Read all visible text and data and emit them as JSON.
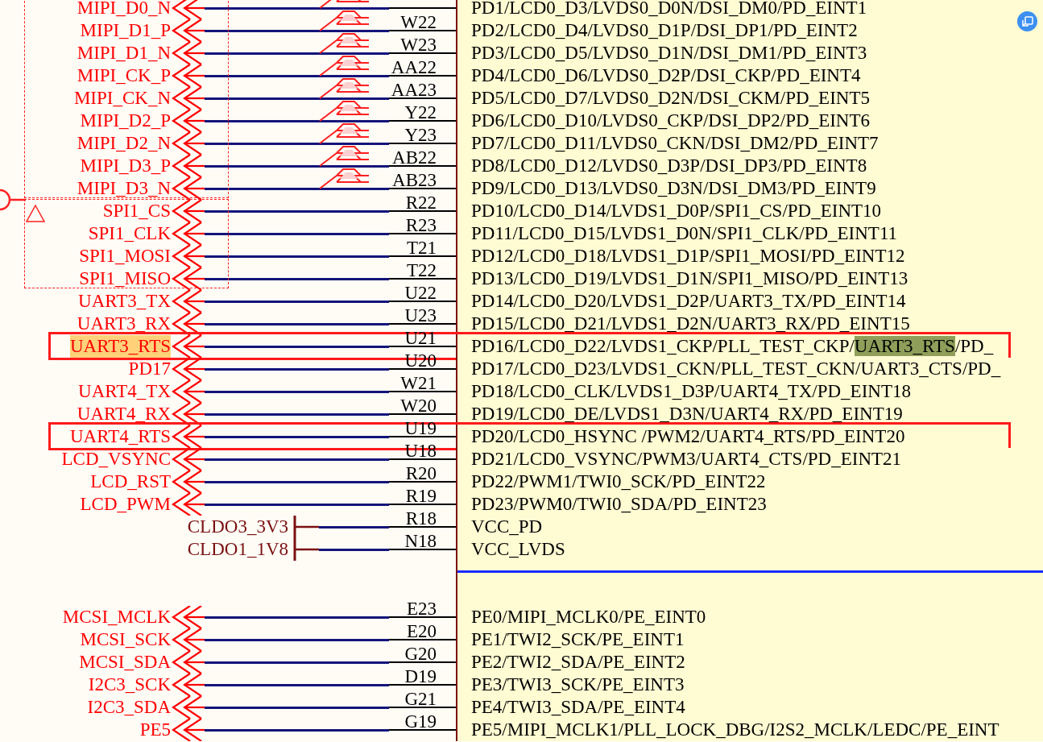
{
  "sections": [
    {
      "rows": [
        {
          "label": "MIPI_D0_N",
          "kind": "signal",
          "diff_pair": true,
          "label_highlighted": false,
          "boxed": false,
          "name_parts": [
            {
              "text": "PD1/LCD0_D3/LVDS0_D0N/DSI_DM0/PD_EINT1",
              "highlighted": false
            }
          ]
        },
        {
          "label": "MIPI_D1_P",
          "kind": "signal",
          "diff_pair": true,
          "label_highlighted": false,
          "boxed": false,
          "pin": "W22",
          "name_parts": [
            {
              "text": "PD2/LCD0_D4/LVDS0_D1P/DSI_DP1/PD_EINT2",
              "highlighted": false
            }
          ]
        },
        {
          "label": "MIPI_D1_N",
          "kind": "signal",
          "diff_pair": true,
          "label_highlighted": false,
          "boxed": false,
          "pin": "W23",
          "name_parts": [
            {
              "text": "PD3/LCD0_D5/LVDS0_D1N/DSI_DM1/PD_EINT3",
              "highlighted": false
            }
          ]
        },
        {
          "label": "MIPI_CK_P",
          "kind": "signal",
          "diff_pair": true,
          "label_highlighted": false,
          "boxed": false,
          "pin": "AA22",
          "name_parts": [
            {
              "text": "PD4/LCD0_D6/LVDS0_D2P/DSI_CKP/PD_EINT4",
              "highlighted": false
            }
          ]
        },
        {
          "label": "MIPI_CK_N",
          "kind": "signal",
          "diff_pair": true,
          "label_highlighted": false,
          "boxed": false,
          "pin": "AA23",
          "name_parts": [
            {
              "text": "PD5/LCD0_D7/LVDS0_D2N/DSI_CKM/PD_EINT5",
              "highlighted": false
            }
          ]
        },
        {
          "label": "MIPI_D2_P",
          "kind": "signal",
          "diff_pair": true,
          "label_highlighted": false,
          "boxed": false,
          "pin": "Y22",
          "name_parts": [
            {
              "text": "PD6/LCD0_D10/LVDS0_CKP/DSI_DP2/PD_EINT6",
              "highlighted": false
            }
          ]
        },
        {
          "label": "MIPI_D2_N",
          "kind": "signal",
          "diff_pair": true,
          "label_highlighted": false,
          "boxed": false,
          "pin": "Y23",
          "name_parts": [
            {
              "text": "PD7/LCD0_D11/LVDS0_CKN/DSI_DM2/PD_EINT7",
              "highlighted": false
            }
          ]
        },
        {
          "label": "MIPI_D3_P",
          "kind": "signal",
          "diff_pair": true,
          "label_highlighted": false,
          "boxed": false,
          "pin": "AB22",
          "name_parts": [
            {
              "text": "PD8/LCD0_D12/LVDS0_D3P/DSI_DP3/PD_EINT8",
              "highlighted": false
            }
          ]
        },
        {
          "label": "MIPI_D3_N",
          "kind": "signal",
          "diff_pair": true,
          "label_highlighted": false,
          "boxed": false,
          "pin": "AB23",
          "name_parts": [
            {
              "text": "PD9/LCD0_D13/LVDS0_D3N/DSI_DM3/PD_EINT9",
              "highlighted": false
            }
          ]
        },
        {
          "label": "SPI1_CS",
          "kind": "signal",
          "diff_pair": false,
          "label_highlighted": false,
          "boxed": false,
          "pin": "R22",
          "name_parts": [
            {
              "text": "PD10/LCD0_D14/LVDS1_D0P/SPI1_CS/PD_EINT10",
              "highlighted": false
            }
          ]
        },
        {
          "label": "SPI1_CLK",
          "kind": "signal",
          "diff_pair": false,
          "label_highlighted": false,
          "boxed": false,
          "pin": "R23",
          "name_parts": [
            {
              "text": "PD11/LCD0_D15/LVDS1_D0N/SPI1_CLK/PD_EINT11",
              "highlighted": false
            }
          ]
        },
        {
          "label": "SPI1_MOSI",
          "kind": "signal",
          "diff_pair": false,
          "label_highlighted": false,
          "boxed": false,
          "pin": "T21",
          "name_parts": [
            {
              "text": "PD12/LCD0_D18/LVDS1_D1P/SPI1_MOSI/PD_EINT12",
              "highlighted": false
            }
          ]
        },
        {
          "label": "SPI1_MISO",
          "kind": "signal",
          "diff_pair": false,
          "label_highlighted": false,
          "boxed": false,
          "pin": "T22",
          "name_parts": [
            {
              "text": "PD13/LCD0_D19/LVDS1_D1N/SPI1_MISO/PD_EINT13",
              "highlighted": false
            }
          ]
        },
        {
          "label": "UART3_TX",
          "kind": "signal",
          "diff_pair": false,
          "label_highlighted": false,
          "boxed": false,
          "pin": "U22",
          "name_parts": [
            {
              "text": "PD14/LCD0_D20/LVDS1_D2P/UART3_TX/PD_EINT14",
              "highlighted": false
            }
          ]
        },
        {
          "label": "UART3_RX",
          "kind": "signal",
          "diff_pair": false,
          "label_highlighted": false,
          "boxed": false,
          "pin": "U23",
          "name_parts": [
            {
              "text": "PD15/LCD0_D21/LVDS1_D2N/UART3_RX/PD_EINT15",
              "highlighted": false
            }
          ]
        },
        {
          "label": "UART3_RTS",
          "kind": "signal",
          "diff_pair": false,
          "label_highlighted": true,
          "boxed": true,
          "pin": "U21",
          "name_parts": [
            {
              "text": "PD16/LCD0_D22/LVDS1_CKP/PLL_TEST_CKP/",
              "highlighted": false
            },
            {
              "text": "UART3_RTS",
              "highlighted": true
            },
            {
              "text": "/PD_",
              "highlighted": false
            }
          ]
        },
        {
          "label": "PD17",
          "kind": "signal",
          "diff_pair": false,
          "label_highlighted": false,
          "boxed": false,
          "pin": "U20",
          "name_parts": [
            {
              "text": "PD17/LCD0_D23/LVDS1_CKN/PLL_TEST_CKN/UART3_CTS/PD_",
              "highlighted": false
            }
          ]
        },
        {
          "label": "UART4_TX",
          "kind": "signal",
          "diff_pair": false,
          "label_highlighted": false,
          "boxed": false,
          "pin": "W21",
          "name_parts": [
            {
              "text": "PD18/LCD0_CLK/LVDS1_D3P/UART4_TX/PD_EINT18",
              "highlighted": false
            }
          ]
        },
        {
          "label": "UART4_RX",
          "kind": "signal",
          "diff_pair": false,
          "label_highlighted": false,
          "boxed": false,
          "pin": "W20",
          "name_parts": [
            {
              "text": "PD19/LCD0_DE/LVDS1_D3N/UART4_RX/PD_EINT19",
              "highlighted": false
            }
          ]
        },
        {
          "label": "UART4_RTS",
          "kind": "signal",
          "diff_pair": false,
          "label_highlighted": false,
          "boxed": true,
          "pin": "U19",
          "name_parts": [
            {
              "text": "PD20/LCD0_HSYNC /PWM2/UART4_RTS/PD_EINT20",
              "highlighted": false
            }
          ]
        },
        {
          "label": "LCD_VSYNC",
          "kind": "signal",
          "diff_pair": false,
          "label_highlighted": false,
          "boxed": false,
          "pin": "U18",
          "name_parts": [
            {
              "text": "PD21/LCD0_VSYNC/PWM3/UART4_CTS/PD_EINT21",
              "highlighted": false
            }
          ]
        },
        {
          "label": "LCD_RST",
          "kind": "signal",
          "diff_pair": false,
          "label_highlighted": false,
          "boxed": false,
          "pin": "R20",
          "name_parts": [
            {
              "text": "PD22/PWM1/TWI0_SCK/PD_EINT22",
              "highlighted": false
            }
          ]
        },
        {
          "label": "LCD_PWM",
          "kind": "signal",
          "diff_pair": false,
          "label_highlighted": false,
          "boxed": false,
          "pin": "R19",
          "name_parts": [
            {
              "text": "PD23/PWM0/TWI0_SDA/PD_EINT23",
              "highlighted": false
            }
          ]
        },
        {
          "label": "CLDO3_3V3",
          "kind": "power",
          "diff_pair": false,
          "label_highlighted": false,
          "boxed": false,
          "pin": "R18",
          "name_parts": [
            {
              "text": "VCC_PD",
              "highlighted": false
            }
          ]
        },
        {
          "label": "CLDO1_1V8",
          "kind": "power",
          "diff_pair": false,
          "label_highlighted": false,
          "boxed": false,
          "pin": "N18",
          "name_parts": [
            {
              "text": "VCC_LVDS",
              "highlighted": false
            }
          ]
        }
      ]
    },
    {
      "rows": [
        {
          "label": "MCSI_MCLK",
          "kind": "signal",
          "diff_pair": false,
          "label_highlighted": false,
          "boxed": false,
          "pin": "E23",
          "name_parts": [
            {
              "text": "PE0/MIPI_MCLK0/PE_EINT0",
              "highlighted": false
            }
          ]
        },
        {
          "label": "MCSI_SCK",
          "kind": "signal",
          "diff_pair": false,
          "label_highlighted": false,
          "boxed": false,
          "pin": "E20",
          "name_parts": [
            {
              "text": "PE1/TWI2_SCK/PE_EINT1",
              "highlighted": false
            }
          ]
        },
        {
          "label": "MCSI_SDA",
          "kind": "signal",
          "diff_pair": false,
          "label_highlighted": false,
          "boxed": false,
          "pin": "G20",
          "name_parts": [
            {
              "text": "PE2/TWI2_SDA/PE_EINT2",
              "highlighted": false
            }
          ]
        },
        {
          "label": "I2C3_SCK",
          "kind": "signal",
          "diff_pair": false,
          "label_highlighted": false,
          "boxed": false,
          "pin": "D19",
          "name_parts": [
            {
              "text": "PE3/TWI3_SCK/PE_EINT3",
              "highlighted": false
            }
          ]
        },
        {
          "label": "I2C3_SDA",
          "kind": "signal",
          "diff_pair": false,
          "label_highlighted": false,
          "boxed": false,
          "pin": "G21",
          "name_parts": [
            {
              "text": "PE4/TWI3_SDA/PE_EINT4",
              "highlighted": false
            }
          ]
        },
        {
          "label": "PE5",
          "kind": "signal",
          "diff_pair": false,
          "label_highlighted": false,
          "boxed": false,
          "pin": "G19",
          "name_parts": [
            {
              "text": "PE5/MIPI_MCLK1/PLL_LOCK_DBG/I2S2_MCLK/LEDC/PE_EINT",
              "highlighted": false
            }
          ]
        }
      ]
    }
  ]
}
